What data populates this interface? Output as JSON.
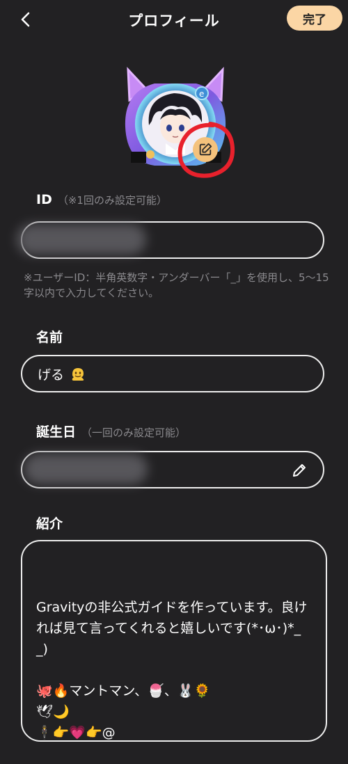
{
  "header": {
    "title": "プロフィール",
    "done_label": "完了"
  },
  "id_section": {
    "label": "ID",
    "hint": "（※1回のみ設定可能）",
    "value": "",
    "note": "※ユーザーID：半角英数字・アンダーバー「_」を使用し、5〜15字以内で入力してください。"
  },
  "name_section": {
    "label": "名前",
    "value": "げる"
  },
  "birthday_section": {
    "label": "誕生日",
    "hint": "（一回のみ設定可能）",
    "value": ""
  },
  "bio_section": {
    "label": "紹介",
    "value": "Gravityの非公式ガイドを作っています。良ければ見て言ってくれると嬉しいです(*･ω･)*_ _)\n\n🐙🔥マントマン、🍧、🐰🌻\n🕊🌙\n🕴👉💗👉@"
  },
  "icons": {
    "back": "chevron-left-icon",
    "edit": "edit-square-icon",
    "pencil": "pencil-icon",
    "emoji": "melting-face-icon"
  },
  "colors": {
    "background": "#222123",
    "accent": "#fbd6a5",
    "badge": "#f4c27c",
    "annotation_red": "#e8212c"
  }
}
